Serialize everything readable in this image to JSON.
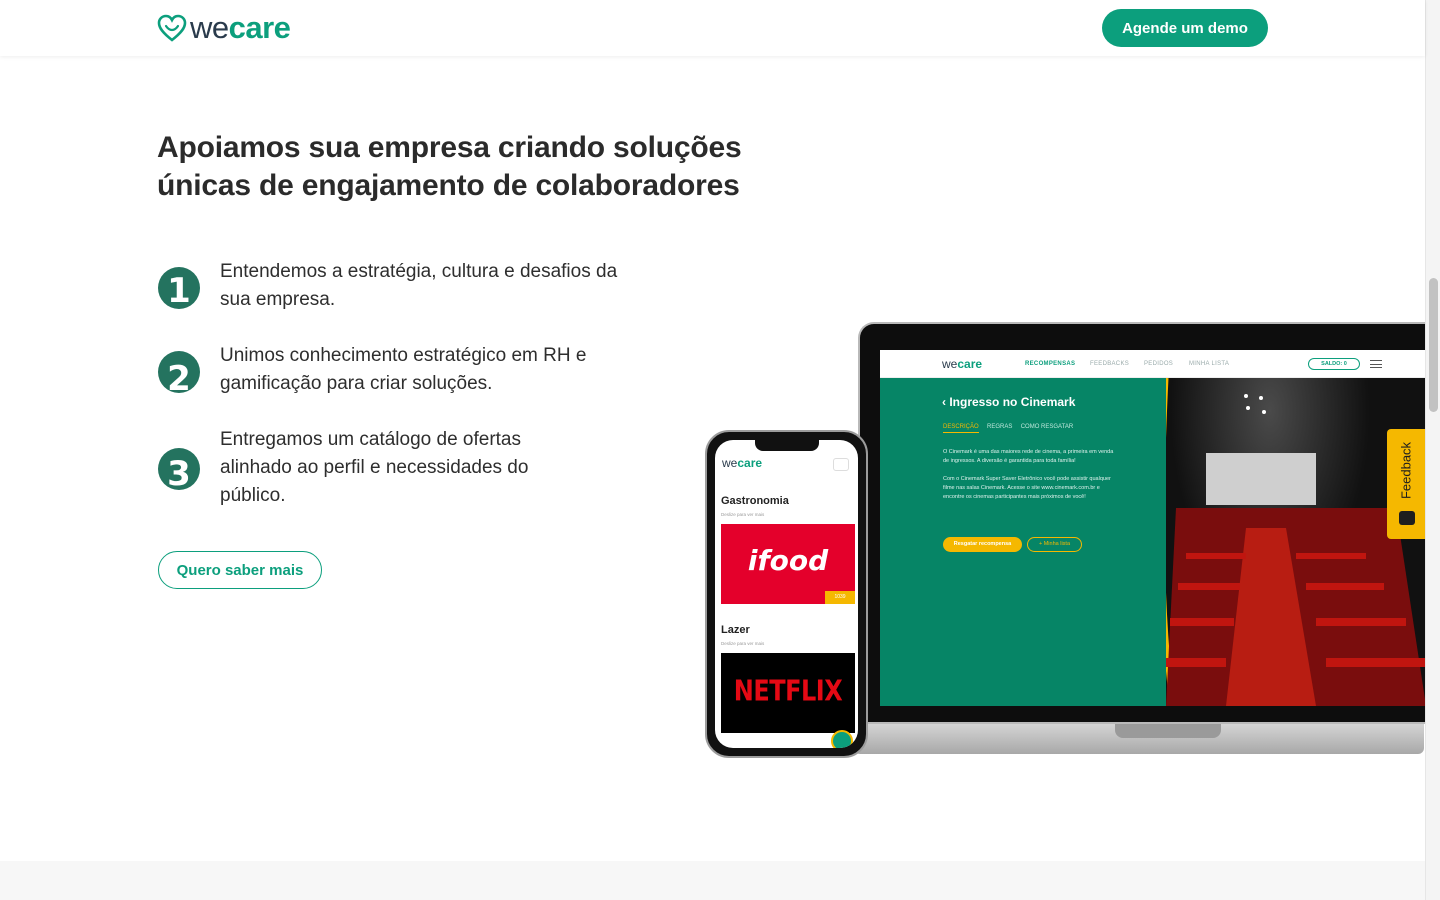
{
  "brand": {
    "we": "we",
    "care": "care",
    "accent_color": "#0c9f7d"
  },
  "header": {
    "cta_label": "Agende um demo"
  },
  "hero": {
    "headline": "Apoiamos sua empresa criando soluções únicas de engajamento de colaboradores",
    "steps": [
      {
        "number": "1",
        "text": "Entendemos a estratégia, cultura e desafios da sua empresa."
      },
      {
        "number": "2",
        "text": "Unimos conhecimento estratégico em RH e gamificação para criar soluções."
      },
      {
        "number": "3",
        "text": "Entregamos um catálogo de ofertas alinhado ao perfil e necessidades do público."
      }
    ],
    "cta_label": "Quero saber mais"
  },
  "laptop_screen": {
    "menu": [
      "RECOMPENSAS",
      "FEEDBACKS",
      "PEDIDOS",
      "MINHA LISTA"
    ],
    "saldo": "SALDO: 0",
    "title": "Ingresso no Cinemark",
    "tabs": [
      "DESCRIÇÃO",
      "REGRAS",
      "COMO RESGATAR"
    ],
    "desc1": "O Cinemark é uma das maiores rede de cinema, a primeira em venda de ingressos. A diversão é garantida para toda família!",
    "desc2": "Com o Cinemark Super Saver Eletrônico você pode assistir qualquer filme nas salas Cinemark. Acesse o site www.cinemark.com.br e encontre os cinemas participantes mais próximos de você!",
    "btn_redeem": "Resgatar recompensa",
    "btn_list": "+ Minha lista"
  },
  "phone_screen": {
    "categories": [
      {
        "title": "Gastronomia",
        "subtitle": "Deslize para ver mais",
        "brand": "ifood",
        "price": "1039"
      },
      {
        "title": "Lazer",
        "subtitle": "Deslize para ver mais",
        "brand": "NETFLIX",
        "price": ""
      }
    ]
  },
  "feedback_tab": {
    "label": "Feedback"
  }
}
